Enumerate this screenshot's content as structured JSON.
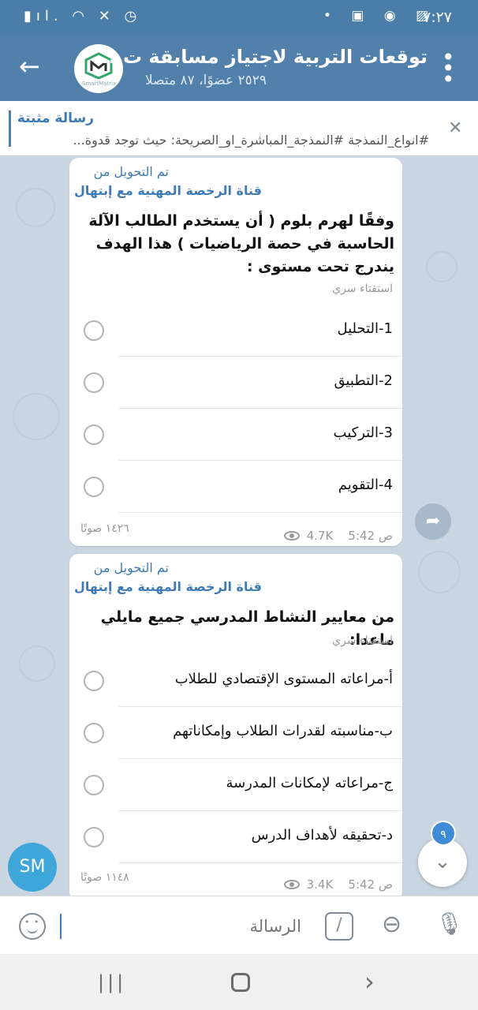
{
  "status": {
    "time": "٧:٢٧",
    "icons_left": [
      "battery-icon",
      "signal-icon",
      "wifi-icon",
      "mute-icon",
      "alarm-icon"
    ],
    "icons_right": [
      "dot-icon",
      "facebook-icon",
      "notification-icon",
      "image-icon"
    ]
  },
  "header": {
    "title": "توقعات التربية لاجتياز مسابقة ت...",
    "subtitle": "٢٥٢٩ عضوًا، ٨٧ متصلا",
    "avatar_text": "SmartMatrix"
  },
  "pinned": {
    "title": "رسالة مثبتة",
    "text": "#انواع_النمذجة #النمذجة_المباشرة_او_الصريحة: حيث توجد قدوة..."
  },
  "messages": [
    {
      "forwarded_label": "تم التحويل من",
      "forwarded_from": "قناة الرخصة المهنية مع إبتهال",
      "question": "وفقًا لهرم بلوم ( أن يستخدم الطالب الآلة الحاسبة في حصة الرياضيات ) هذا الهدف يندرج تحت مستوى :",
      "poll_type": "استفتاء سري",
      "options": [
        "1-التحليل",
        "2-التطبيق",
        "3-التركيب",
        "4-التقويم"
      ],
      "votes": "١٤٢٦ صوتًا",
      "views": "4.7K",
      "time": "5:42 ص"
    },
    {
      "forwarded_label": "تم التحويل من",
      "forwarded_from": "قناة الرخصة المهنية مع إبتهال",
      "question": "من معايير النشاط المدرسي جميع مايلي ماعدا:",
      "poll_type": "استفتاء سري",
      "options": [
        "أ-مراعاته المستوى الإقتصادي للطلاب",
        "ب-مناسبته لقدرات الطلاب وإمكاناتهم",
        "ج-مراعاته لإمكانات المدرسة",
        "د-تحقيقه لأهداف الدرس"
      ],
      "votes": "١١٤٨ صوتًا",
      "views": "3.4K",
      "time": "5:42 ص"
    }
  ],
  "user_avatar": "SM",
  "unread_count": "٩",
  "input": {
    "placeholder": "الرسالة"
  },
  "colors": {
    "header": "#5181ab",
    "accent": "#3e7bb6",
    "chat_bg": "#c9d6e2"
  }
}
